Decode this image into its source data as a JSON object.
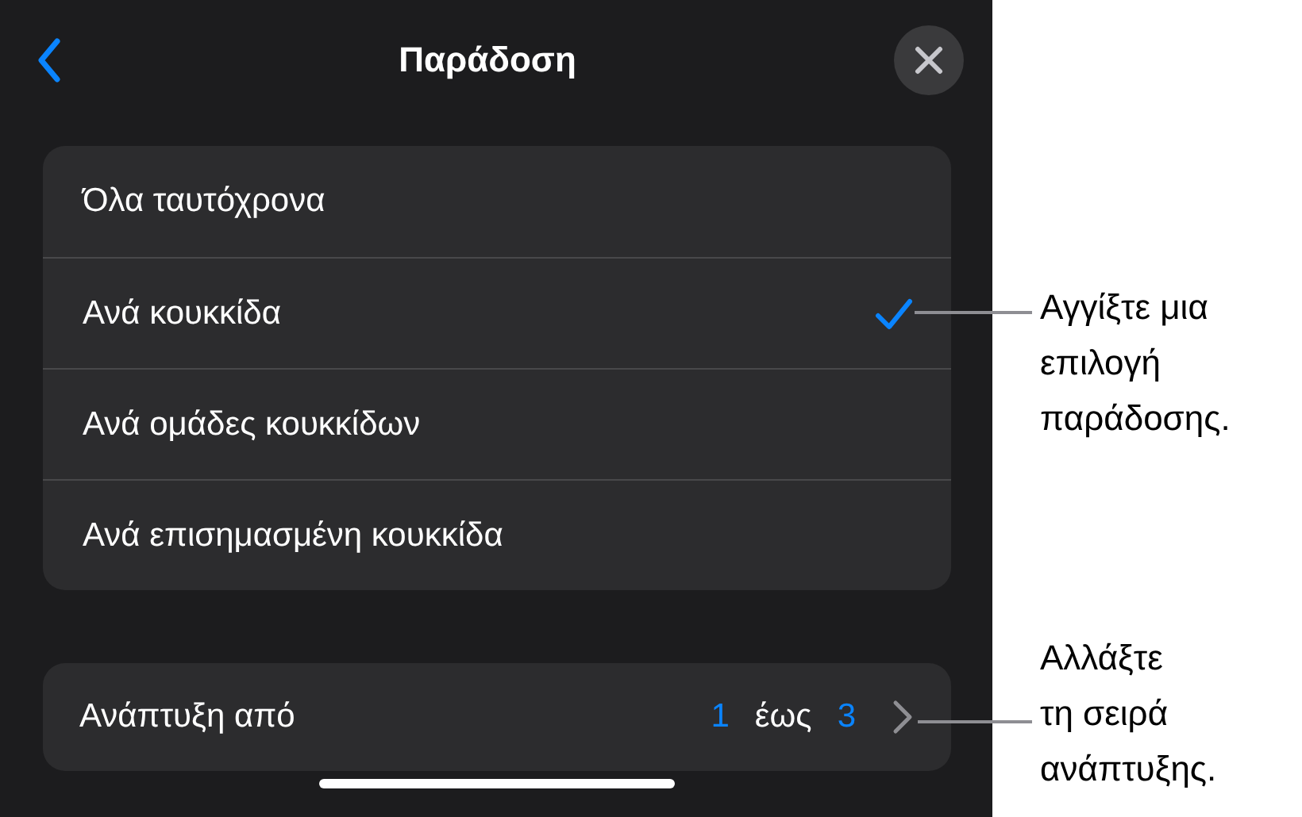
{
  "header": {
    "title": "Παράδοση"
  },
  "options": [
    {
      "label": "Όλα ταυτόχρονα",
      "selected": false
    },
    {
      "label": "Ανά κουκκίδα",
      "selected": true
    },
    {
      "label": "Ανά ομάδες κουκκίδων",
      "selected": false
    },
    {
      "label": "Ανά επισημασμένη κουκκίδα",
      "selected": false
    }
  ],
  "build": {
    "label": "Ανάπτυξη από",
    "from": "1",
    "to_word": "έως",
    "to": "3"
  },
  "callouts": [
    "Αγγίξτε μια\nεπιλογή\nπαράδοσης.",
    "Αλλάξτε\nτη σειρά\nανάπτυξης."
  ]
}
